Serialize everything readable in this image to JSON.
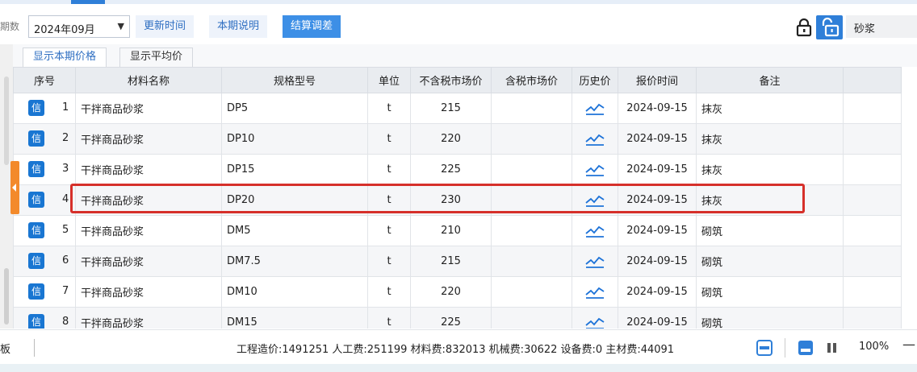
{
  "toolbar": {
    "period_label": "期数",
    "period_value": "2024年09月",
    "update_time_label": "更新时间",
    "period_notes_label": "本期说明",
    "settle_adjust_label": "结算调差",
    "filter_value": "砂浆"
  },
  "subtabs": {
    "current_price": "显示本期价格",
    "average_price": "显示平均价"
  },
  "table": {
    "headers": [
      "序号",
      "材料名称",
      "规格型号",
      "单位",
      "不含税市场价",
      "含税市场价",
      "历史价",
      "报价时间",
      "备注"
    ],
    "info_badge": "信",
    "rows": [
      {
        "seq": "1",
        "name": "干拌商品砂浆",
        "spec": "DP5",
        "unit": "t",
        "price_ex_tax": "215",
        "price_inc_tax": "",
        "quote_time": "2024-09-15",
        "note": "抹灰"
      },
      {
        "seq": "2",
        "name": "干拌商品砂浆",
        "spec": "DP10",
        "unit": "t",
        "price_ex_tax": "220",
        "price_inc_tax": "",
        "quote_time": "2024-09-15",
        "note": "抹灰"
      },
      {
        "seq": "3",
        "name": "干拌商品砂浆",
        "spec": "DP15",
        "unit": "t",
        "price_ex_tax": "225",
        "price_inc_tax": "",
        "quote_time": "2024-09-15",
        "note": "抹灰"
      },
      {
        "seq": "4",
        "name": "干拌商品砂浆",
        "spec": "DP20",
        "unit": "t",
        "price_ex_tax": "230",
        "price_inc_tax": "",
        "quote_time": "2024-09-15",
        "note": "抹灰"
      },
      {
        "seq": "5",
        "name": "干拌商品砂浆",
        "spec": "DM5",
        "unit": "t",
        "price_ex_tax": "210",
        "price_inc_tax": "",
        "quote_time": "2024-09-15",
        "note": "砌筑"
      },
      {
        "seq": "6",
        "name": "干拌商品砂浆",
        "spec": "DM7.5",
        "unit": "t",
        "price_ex_tax": "215",
        "price_inc_tax": "",
        "quote_time": "2024-09-15",
        "note": "砌筑"
      },
      {
        "seq": "7",
        "name": "干拌商品砂浆",
        "spec": "DM10",
        "unit": "t",
        "price_ex_tax": "220",
        "price_inc_tax": "",
        "quote_time": "2024-09-15",
        "note": "砌筑"
      },
      {
        "seq": "8",
        "name": "干拌商品砂浆",
        "spec": "DM15",
        "unit": "t",
        "price_ex_tax": "225",
        "price_inc_tax": "",
        "quote_time": "2024-09-15",
        "note": "砌筑"
      }
    ]
  },
  "statusbar": {
    "left_text": "板",
    "summary": "工程造价:1491251  人工费:251199  材料费:832013  机械费:30622  设备费:0  主材费:44091",
    "zoom": "100%",
    "zoom_minus": "—"
  },
  "colors": {
    "accent": "#2f7fd8",
    "badge": "#1976d2",
    "highlight_border": "#d6302a",
    "handle": "#f38a2b"
  }
}
